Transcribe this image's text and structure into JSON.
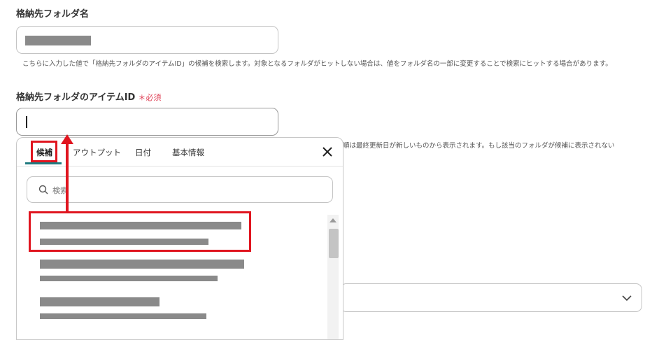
{
  "folder_name": {
    "label": "格納先フォルダ名",
    "hint": "こちらに入力した値で「格納先フォルダのアイテムID」の候補を検索します。対象となるフォルダがヒットしない場合は、値をフォルダ名の一部に変更することで検索にヒットする場合があります。"
  },
  "item_id": {
    "label": "格納先フォルダのアイテムID",
    "required_mark": "＊",
    "required_text": "必須",
    "hint_partial": "順は最終更新日が新しいものから表示されます。もし該当のフォルダが候補に表示されない"
  },
  "picker": {
    "tabs": [
      {
        "label": "候補",
        "active": true
      },
      {
        "label": "アウトプット",
        "active": false
      },
      {
        "label": "日付",
        "active": false
      },
      {
        "label": "基本情報",
        "active": false
      }
    ],
    "search_placeholder": "検索",
    "candidate_count_visible": 3
  },
  "icons": {
    "close": "close-icon",
    "search": "search-icon",
    "chevron": "chevron-down-icon",
    "scroll_up": "scroll-up-icon"
  },
  "colors": {
    "accent": "#1f7a7f",
    "annotation_red": "#e0151f",
    "required_red": "#e0455a",
    "redaction_gray": "#8a8a8a"
  }
}
